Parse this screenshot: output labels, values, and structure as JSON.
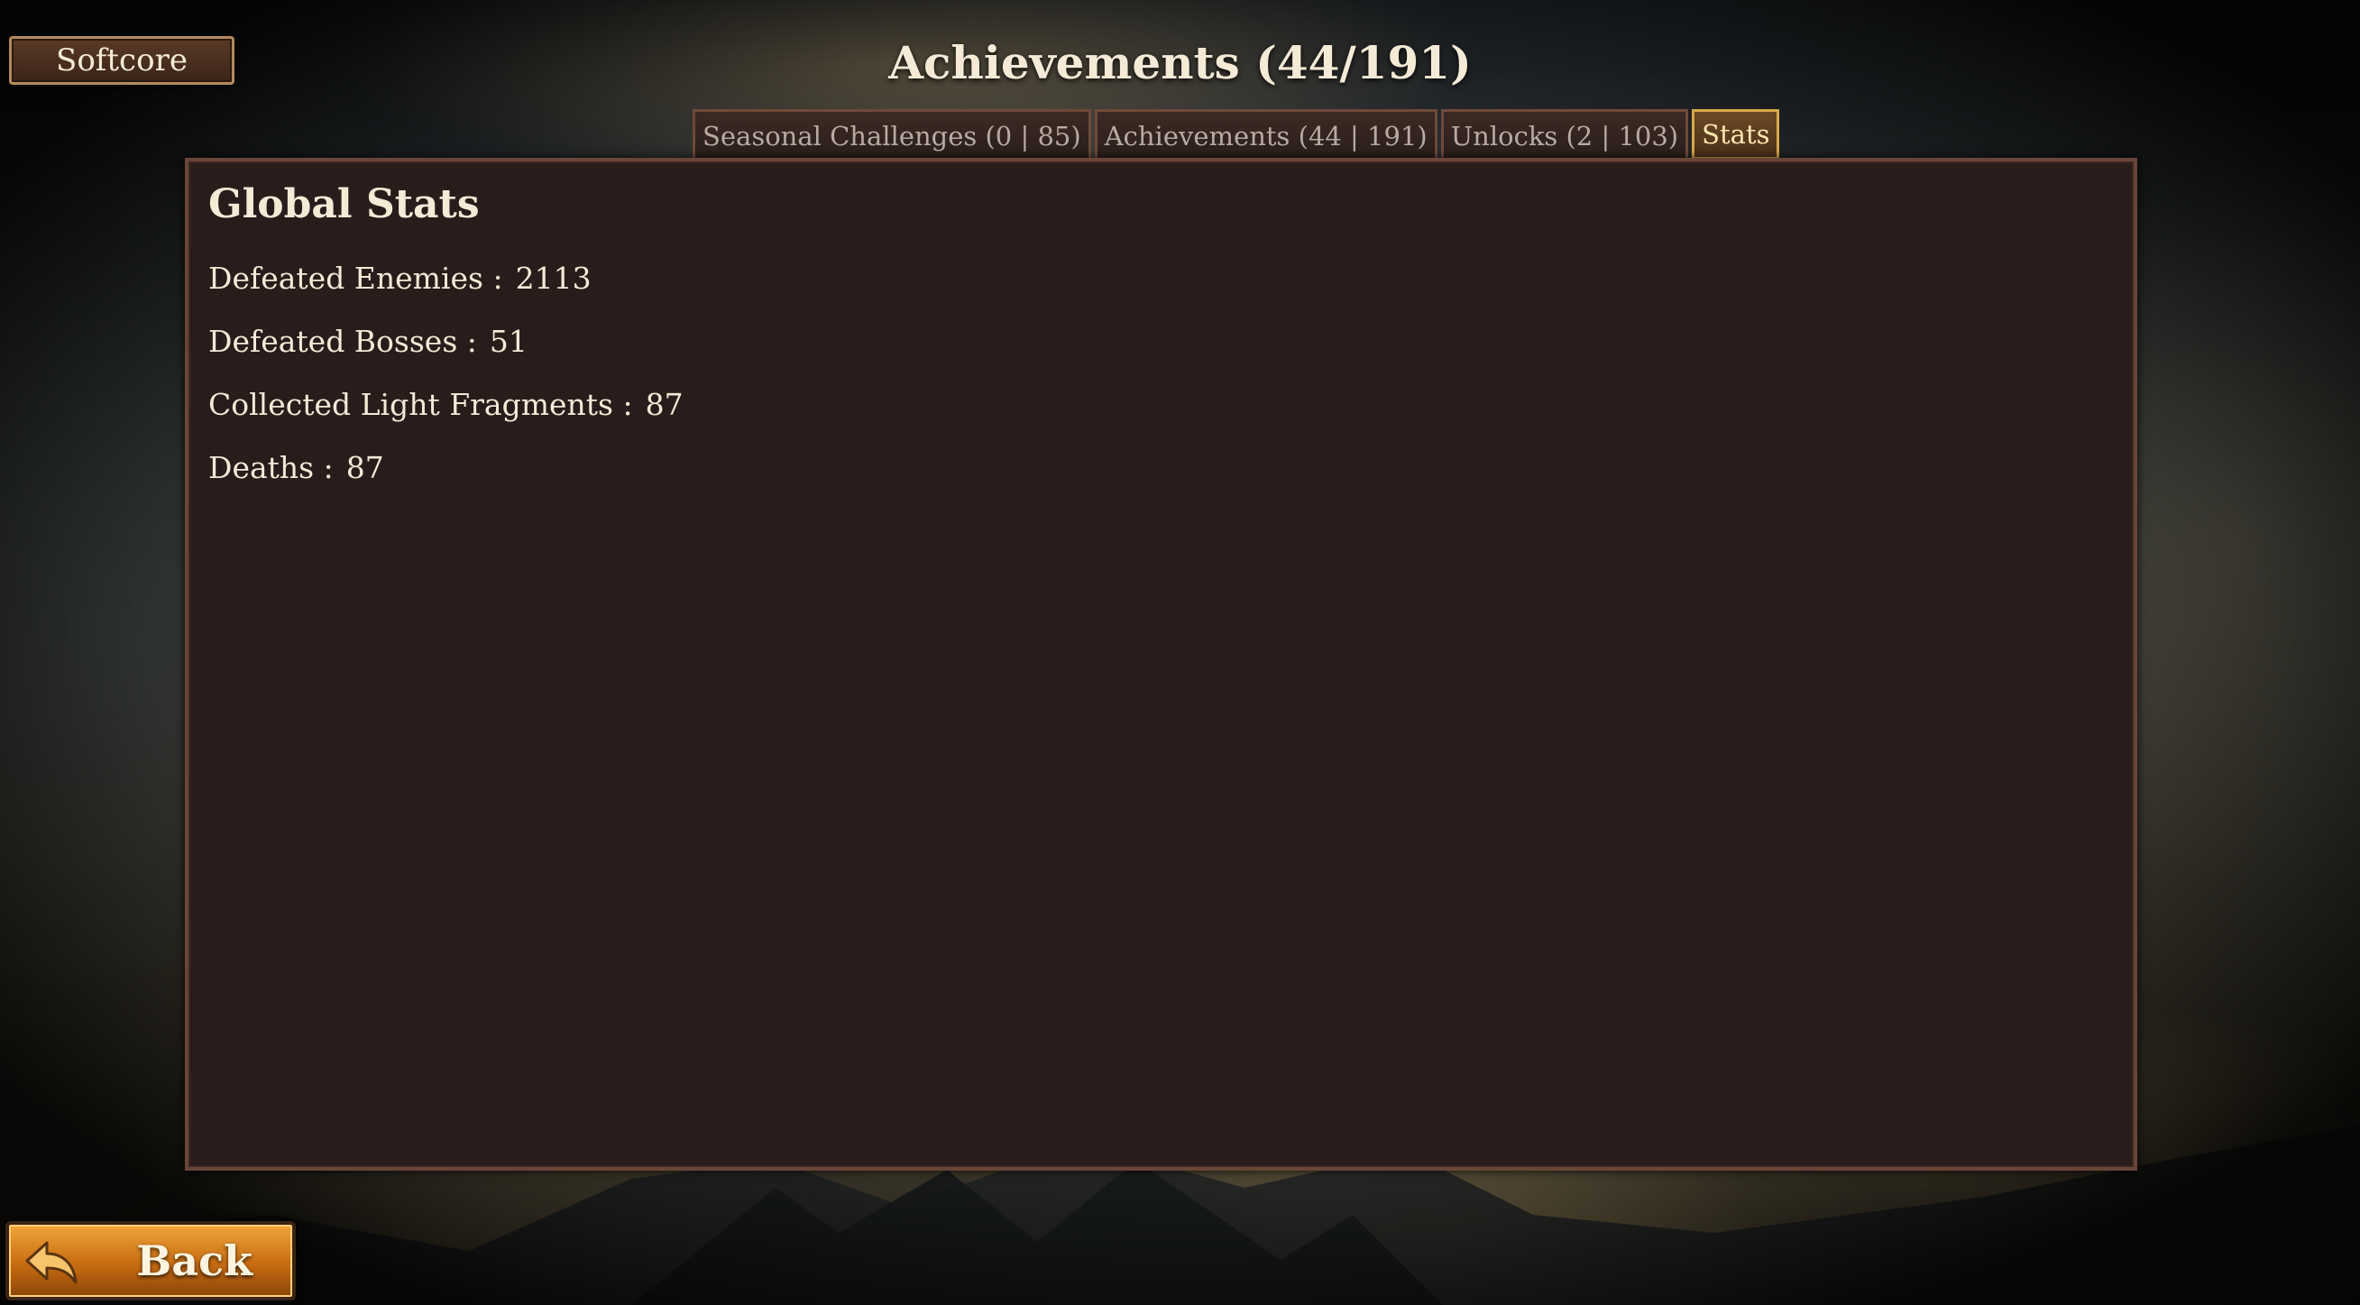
{
  "header": {
    "mode_label": "Softcore",
    "title": "Achievements (44/191)"
  },
  "tabs": [
    {
      "label": "Seasonal Challenges (0 | 85)",
      "active": false
    },
    {
      "label": "Achievements (44 | 191)",
      "active": false
    },
    {
      "label": "Unlocks (2 | 103)",
      "active": false
    },
    {
      "label": "Stats",
      "active": true
    }
  ],
  "panel": {
    "title": "Global Stats",
    "stats": [
      {
        "label": "Defeated Enemies :",
        "value": "2113"
      },
      {
        "label": "Defeated Bosses :",
        "value": "51"
      },
      {
        "label": "Collected Light Fragments :",
        "value": "87"
      },
      {
        "label": "Deaths :",
        "value": "87"
      }
    ]
  },
  "footer": {
    "back_label": "Back",
    "back_icon": "back-arrow-icon"
  },
  "colors": {
    "panel_bg": "#2a1c1a",
    "active_tab_border": "#d9a94a",
    "back_button": "#c86c12"
  }
}
